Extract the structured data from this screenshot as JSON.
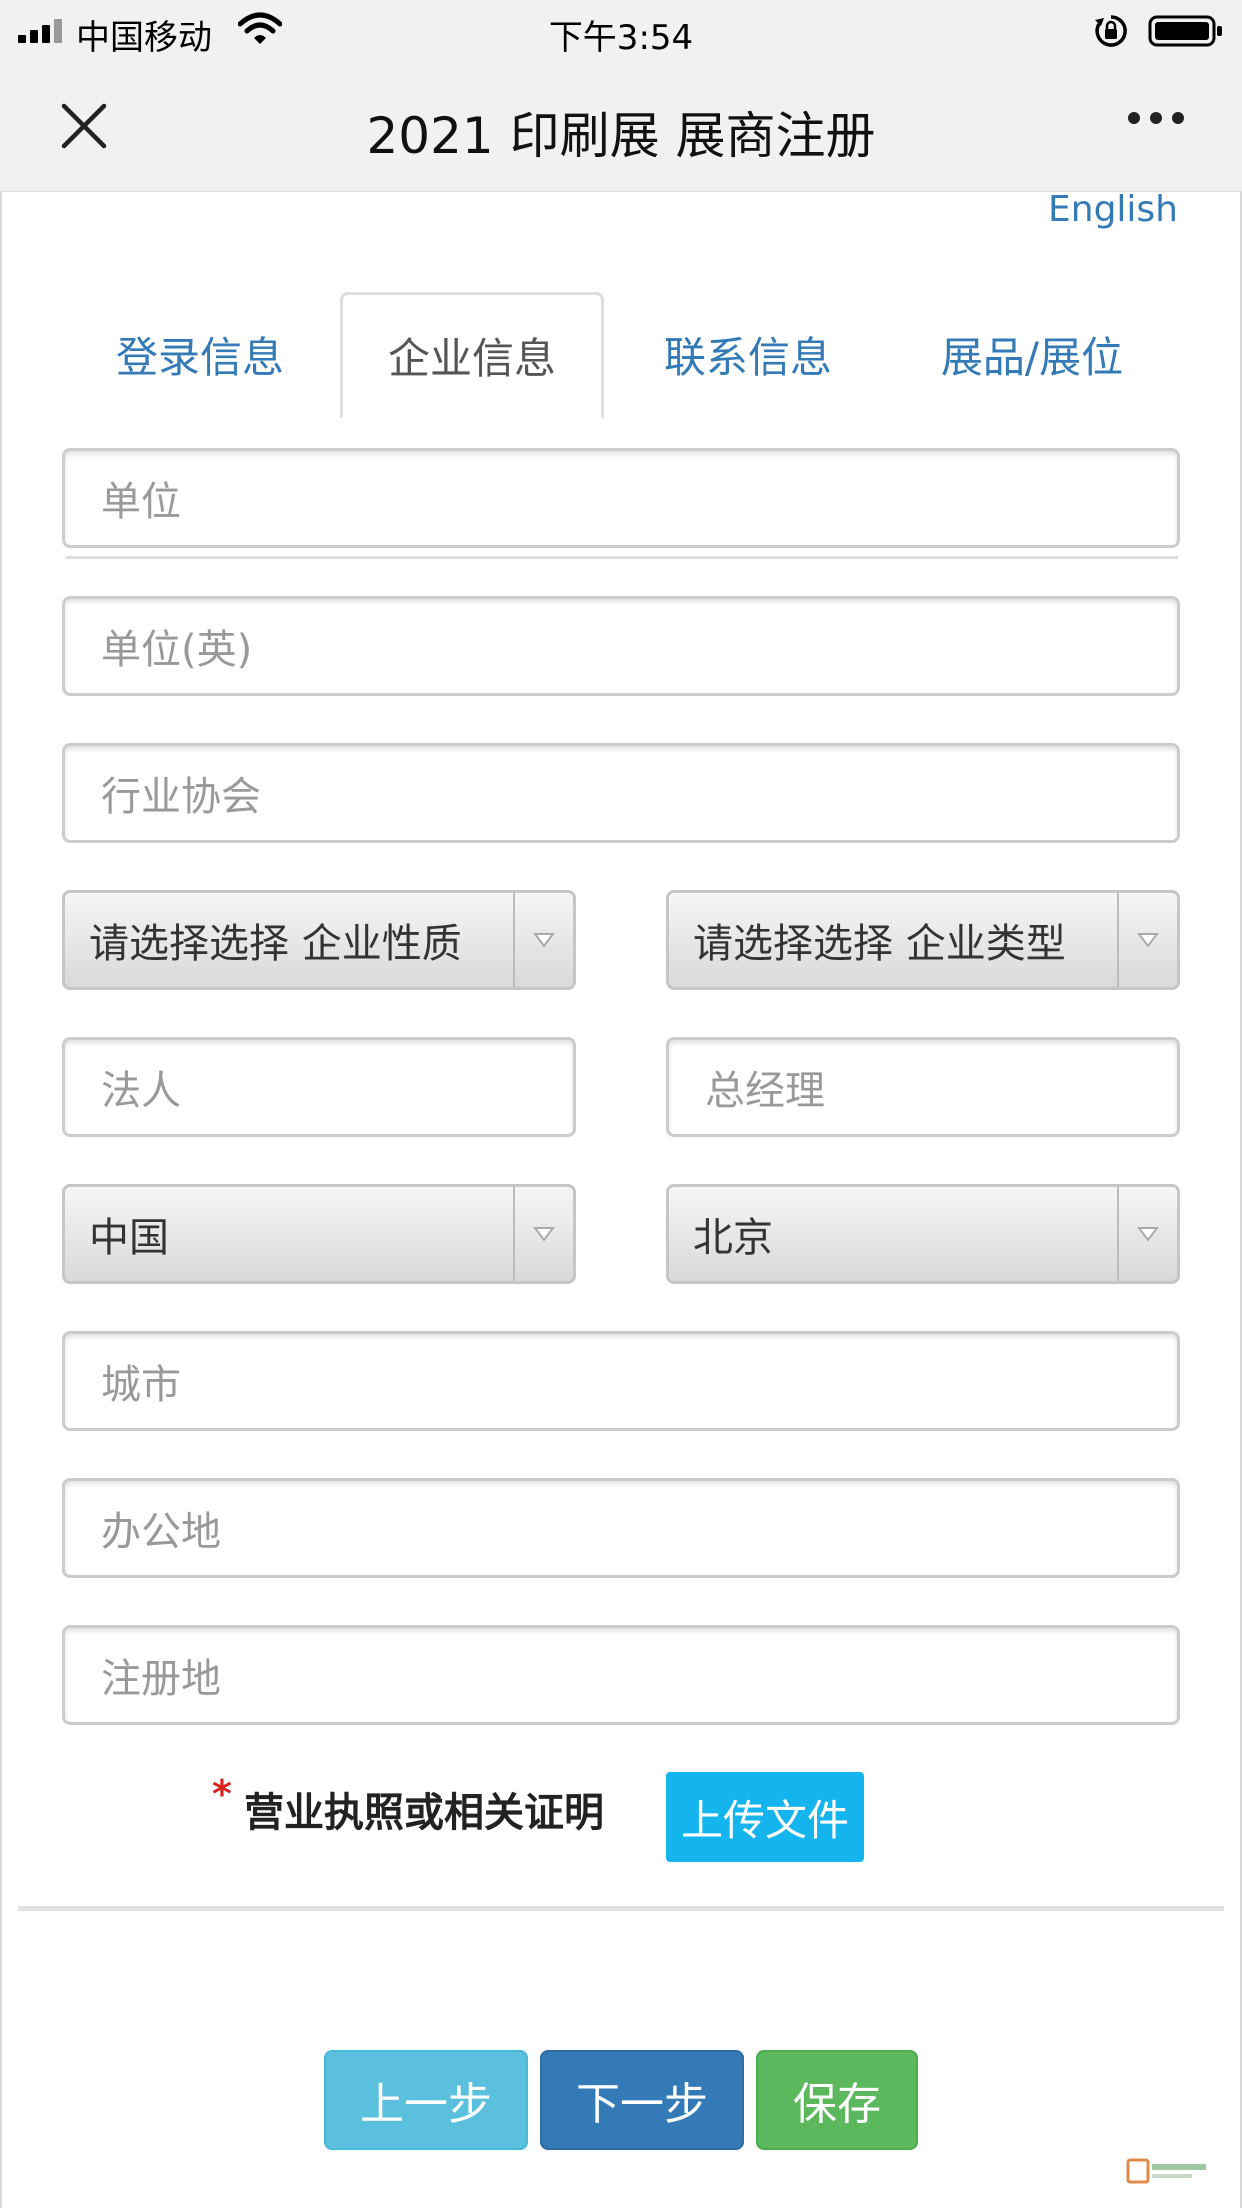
{
  "status_bar": {
    "carrier": "中国移动",
    "time": "下午3:54"
  },
  "nav": {
    "title": "2021 印刷展 展商注册"
  },
  "language_link": "English",
  "tabs": [
    {
      "label": "登录信息",
      "active": false
    },
    {
      "label": "企业信息",
      "active": true
    },
    {
      "label": "联系信息",
      "active": false
    },
    {
      "label": "展品/展位",
      "active": false
    }
  ],
  "form": {
    "company_placeholder": "单位",
    "company_en_placeholder": "单位(英)",
    "association_placeholder": "行业协会",
    "nature_select": "请选择选择 企业性质",
    "type_select": "请选择选择 企业类型",
    "legal_person_placeholder": "法人",
    "general_manager_placeholder": "总经理",
    "country_select": "中国",
    "province_select": "北京",
    "city_placeholder": "城市",
    "office_placeholder": "办公地",
    "registered_address_placeholder": "注册地"
  },
  "upload": {
    "required_mark": "*",
    "label": "营业执照或相关证明",
    "button": "上传文件"
  },
  "actions": {
    "prev": "上一步",
    "next": "下一步",
    "save": "保存"
  },
  "colors": {
    "link_blue": "#337ab7",
    "upload_blue": "#14b4ee",
    "prev_button": "#5bc0de",
    "next_button": "#337ab7",
    "save_button": "#5cb85c",
    "required_red": "#d9211e"
  }
}
